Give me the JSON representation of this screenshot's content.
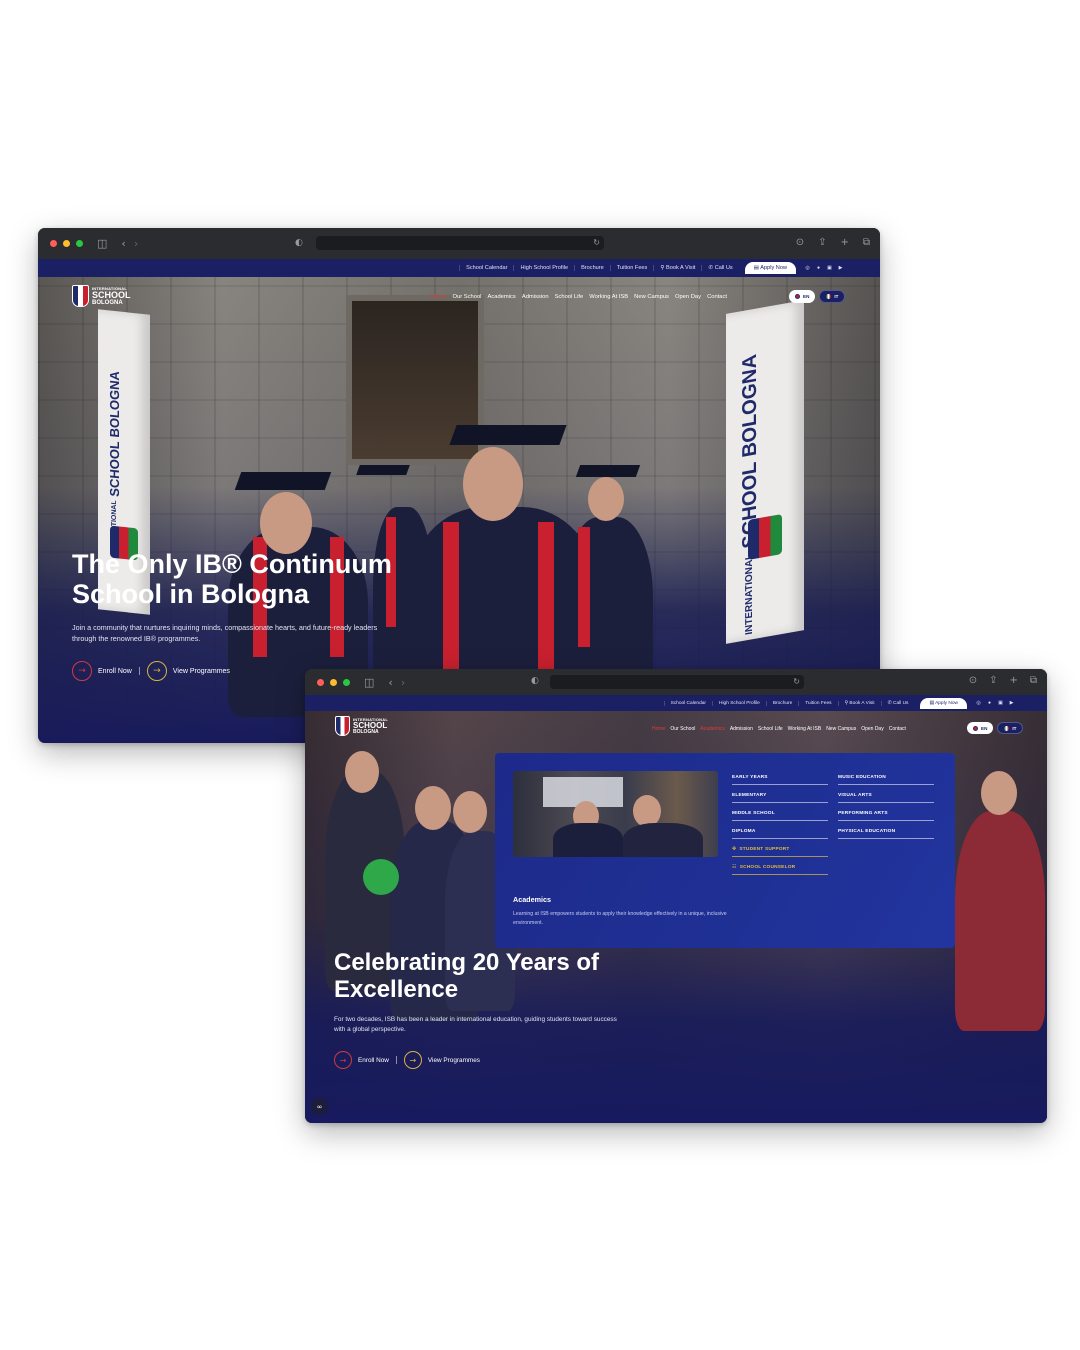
{
  "browser": {
    "icons": [
      "sidebar-icon",
      "back-icon",
      "forward-icon",
      "shield-icon",
      "reload-icon",
      "download-icon",
      "share-icon",
      "new-tab-icon",
      "tabs-icon"
    ],
    "glyphs": {
      "sidebar": "◫",
      "back": "‹",
      "forward": "›",
      "shield": "◐",
      "reload": "↻",
      "download": "⊙",
      "share": "⇪",
      "newtab": "+",
      "tabs": "⧉"
    }
  },
  "utility_bar": {
    "links": [
      "School Calendar",
      "High School Profile",
      "Brochure",
      "Tuition Fees",
      "Book A Visit",
      "Call Us"
    ],
    "apply": "Apply Now",
    "social": [
      "instagram-icon",
      "facebook-icon",
      "linkedin-icon",
      "youtube-icon"
    ]
  },
  "logo": {
    "line1": "INTERNATIONAL",
    "line2": "SCHOOL",
    "line3": "BOLOGNA"
  },
  "nav": {
    "items": [
      "Home",
      "Our School",
      "Academics",
      "Admission",
      "School Life",
      "Working At ISB",
      "New Campus",
      "Open Day",
      "Contact"
    ]
  },
  "lang": {
    "en": "EN",
    "it": "IT"
  },
  "banner": {
    "small": "INTERNATIONAL",
    "big": "SCHOOL",
    "city": "BOLOGNA"
  },
  "window_a": {
    "hero_title": "The Only IB® Continuum School in Bologna",
    "hero_sub": "Join a community that nurtures inquiring minds, compassionate hearts, and future-ready leaders through the renowned IB® programmes.",
    "cta_enroll": "Enroll Now",
    "cta_view": "View Programmes",
    "active_nav": "Home"
  },
  "window_b": {
    "hero_title": "Celebrating 20 Years of Excellence",
    "hero_sub": "For two decades, ISB has been a leader in international education, guiding students toward success with a global perspective.",
    "cta_enroll": "Enroll Now",
    "cta_view": "View Programmes",
    "active_nav": [
      "Home",
      "Academics"
    ],
    "mega_menu": {
      "title": "Academics",
      "description": "Learning at ISB empowers students to apply their knowledge effectively in a unique, inclusive environment.",
      "col1": [
        "EARLY YEARS",
        "ELEMENTARY",
        "MIDDLE SCHOOL",
        "DIPLOMA"
      ],
      "col1_special": [
        "STUDENT SUPPORT",
        "SCHOOL COUNSELOR"
      ],
      "col2": [
        "MUSIC EDUCATION",
        "VISUAL ARTS",
        "PERFORMING ARTS",
        "PHYSICAL EDUCATION"
      ]
    },
    "cc_icon": "closed-captions-icon"
  },
  "colors": {
    "navy": "#1b1f63",
    "accent_red": "#e0393c",
    "accent_gold": "#d6b43a",
    "mega_blue": "#1f3095"
  }
}
